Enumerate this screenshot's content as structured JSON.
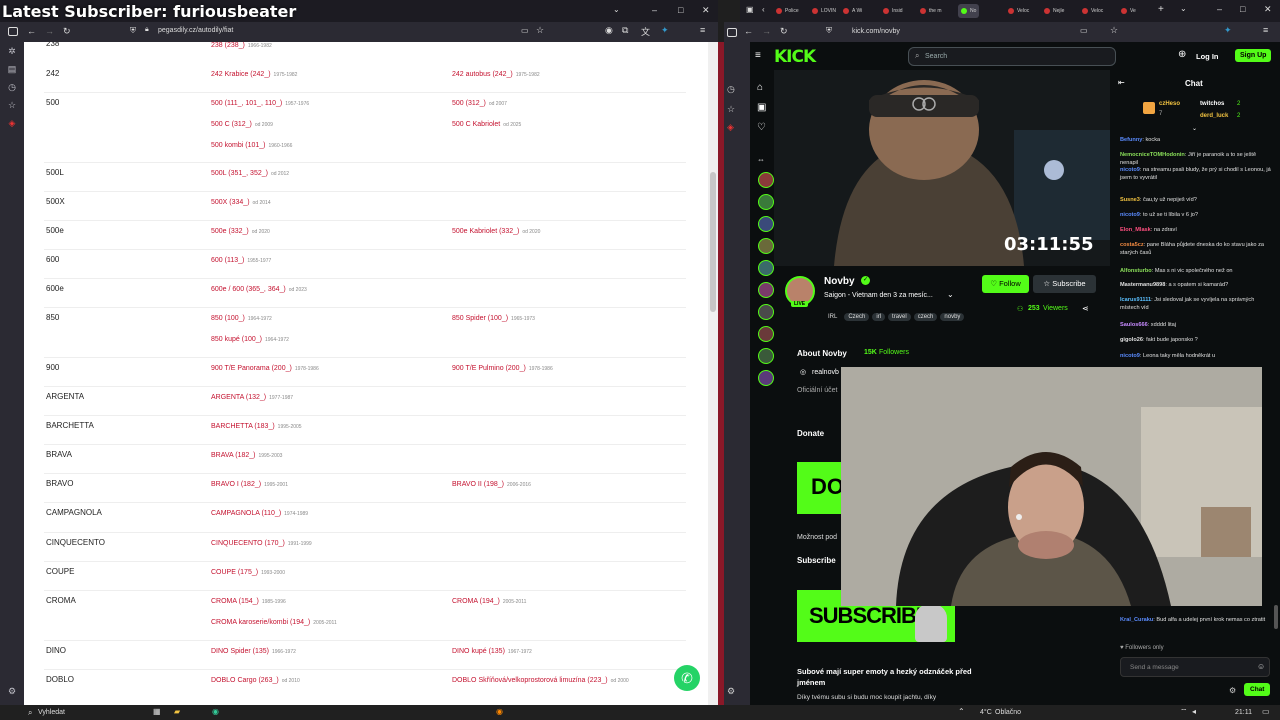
{
  "overlay": {
    "title": "Latest Subscriber: furiousbeater"
  },
  "left": {
    "url": "pegasdily.cz/autodily/fiat",
    "sidebar_icons": [
      "grid-icon",
      "home-icon",
      "download-icon",
      "star-icon",
      "history-icon"
    ],
    "top_partial": {
      "text": "238 (238_)",
      "years": "1966-1982"
    },
    "rows": [
      {
        "model": "242",
        "links": [
          {
            "t": "242 Krabice (242_)",
            "y": "1975-1982"
          },
          {
            "t": "242 autobus (242_)",
            "y": "1975-1982"
          }
        ]
      },
      {
        "model": "500",
        "links": [
          {
            "t": "500 (111_, 101_, 110_)",
            "y": "1957-1976"
          },
          {
            "t": "500 (312_)",
            "y": "od 2007"
          },
          {
            "t": "500 C (312_)",
            "y": "od 2009"
          },
          {
            "t": "500 C Kabriolet",
            "y": "od 2025"
          },
          {
            "t": "500 kombi (101_)",
            "y": "1960-1966"
          }
        ]
      },
      {
        "model": "500L",
        "links": [
          {
            "t": "500L (351_, 352_)",
            "y": "od 2012"
          }
        ]
      },
      {
        "model": "500X",
        "links": [
          {
            "t": "500X (334_)",
            "y": "od 2014"
          }
        ]
      },
      {
        "model": "500e",
        "links": [
          {
            "t": "500e (332_)",
            "y": "od 2020"
          },
          {
            "t": "500e Kabriolet (332_)",
            "y": "od 2020"
          }
        ]
      },
      {
        "model": "600",
        "links": [
          {
            "t": "600 (113_)",
            "y": "1955-1977"
          }
        ]
      },
      {
        "model": "600e",
        "links": [
          {
            "t": "600e / 600 (365_, 364_)",
            "y": "od 2023"
          }
        ]
      },
      {
        "model": "850",
        "links": [
          {
            "t": "850 (100_)",
            "y": "1964-1972"
          },
          {
            "t": "850 Spider (100_)",
            "y": "1965-1973"
          },
          {
            "t": "850 kupé (100_)",
            "y": "1964-1972"
          }
        ]
      },
      {
        "model": "900",
        "links": [
          {
            "t": "900 T/E Panorama (200_)",
            "y": "1978-1986"
          },
          {
            "t": "900 T/E Pulmino (200_)",
            "y": "1978-1986"
          }
        ]
      },
      {
        "model": "ARGENTA",
        "links": [
          {
            "t": "ARGENTA (132_)",
            "y": "1977-1987"
          }
        ]
      },
      {
        "model": "BARCHETTA",
        "links": [
          {
            "t": "BARCHETTA (183_)",
            "y": "1995-2005"
          }
        ]
      },
      {
        "model": "BRAVA",
        "links": [
          {
            "t": "BRAVA (182_)",
            "y": "1995-2003"
          }
        ]
      },
      {
        "model": "BRAVO",
        "links": [
          {
            "t": "BRAVO I (182_)",
            "y": "1995-2001"
          },
          {
            "t": "BRAVO II (198_)",
            "y": "2006-2016"
          }
        ]
      },
      {
        "model": "CAMPAGNOLA",
        "links": [
          {
            "t": "CAMPAGNOLA (110_)",
            "y": "1974-1989"
          }
        ]
      },
      {
        "model": "CINQUECENTO",
        "links": [
          {
            "t": "CINQUECENTO (170_)",
            "y": "1991-1999"
          }
        ]
      },
      {
        "model": "COUPE",
        "links": [
          {
            "t": "COUPE (175_)",
            "y": "1993-2000"
          }
        ]
      },
      {
        "model": "CROMA",
        "links": [
          {
            "t": "CROMA (154_)",
            "y": "1985-1996"
          },
          {
            "t": "CROMA (194_)",
            "y": "2005-2011"
          },
          {
            "t": "CROMA karoserie/kombi (194_)",
            "y": "2005-2011"
          }
        ]
      },
      {
        "model": "DINO",
        "links": [
          {
            "t": "DINO Spider (135)",
            "y": "1966-1972"
          },
          {
            "t": "DINO kupé (135)",
            "y": "1967-1972"
          }
        ]
      },
      {
        "model": "DOBLO",
        "links": [
          {
            "t": "DOBLO Cargo (263_)",
            "y": "od 2010"
          },
          {
            "t": "DOBLO Skříňová/velkoprostorová limuzína (223_)",
            "y": "od 2000"
          }
        ]
      }
    ]
  },
  "right": {
    "url": "kick.com/novby",
    "tabs": [
      "Police",
      "LOVIN",
      "A Wi",
      "Insid",
      "the m",
      "No",
      "Veloc",
      "Nejle",
      "Veloc",
      "Ve"
    ],
    "kick": {
      "logo": "KICK",
      "search_placeholder": "Search",
      "login": "Log In",
      "signup": "Sign Up",
      "timer": "03:11:55",
      "streamer": "Novby",
      "stream_title": "Saigon - Vietnam den 3 za mesíc...",
      "tags": [
        "IRL",
        "Czech",
        "irl",
        "travel",
        "czech",
        "novby"
      ],
      "live_badge": "LIVE",
      "follow": "Follow",
      "subscribe": "Subscribe",
      "viewers": "253",
      "viewers_label": "Viewers",
      "about": "About Novby",
      "followers_count": "15K",
      "followers_label": "Followers",
      "instagram": "realnovb",
      "official": "Oficiální účet",
      "donate": "Donate",
      "donate_banner": "DO",
      "donate_text": "Možnost pod",
      "subscribe_heading": "Subscribe",
      "subscribe_banner": "SUBSCRIBE",
      "sub_title": "Subové mají super emoty a hezký odznáček před jménem",
      "sub_text": "Díky tvému subu si budu moc koupit jachtu, díky"
    },
    "chat": {
      "title": "Chat",
      "top_users": [
        {
          "name": "czHeso",
          "count": "7"
        },
        {
          "name": "twitchos",
          "count": "2"
        },
        {
          "name": "derd_luck",
          "count": "2"
        }
      ],
      "messages": [
        {
          "user": "Befunny",
          "color": "#5b8cff",
          "text": "kocka"
        },
        {
          "user": "NemocniceTOMHodonin",
          "color": "#8be05a",
          "text": "Jiří je paranoik a to se ještě nenapil"
        },
        {
          "user": "nicoto9",
          "color": "#5b8cff",
          "text": "na streamu psali bludy, že prý si chodil s Leonou, já jsem to vyvrátil"
        },
        {
          "user": "Susne3",
          "color": "#f2c341",
          "text": "čau,ty už nepiješ víd?"
        },
        {
          "user": "nicoto9",
          "color": "#5b8cff",
          "text": "to už se ti líbila v 6 jo?"
        },
        {
          "user": "Elon_Mlask",
          "color": "#ff4f7f",
          "text": "na zdraví"
        },
        {
          "user": "costa5cz",
          "color": "#f28a41",
          "text": "pane Bláha půjdete dneska do ko stavu jako za starých časů"
        },
        {
          "user": "Alfonsturbo",
          "color": "#8be05a",
          "text": "Mas s ni vic společného než on"
        },
        {
          "user": "Mastermanu9898",
          "color": "#e0e0e0",
          "text": "a s opatem si kamarád?"
        },
        {
          "user": "Icarus91111",
          "color": "#5bc0ff",
          "text": "Jsi sledoval jak se vyvíjela na správných místech víd"
        },
        {
          "user": "Saulos666",
          "color": "#c78bff",
          "text": "xdddd litaj"
        },
        {
          "user": "gigolo26",
          "color": "#e0e0e0",
          "text": "fakt bude japonsko ?"
        },
        {
          "user": "nicoto9",
          "color": "#5b8cff",
          "text": "Leona taky měla hodněkrát u"
        },
        {
          "user": "Kral_Curaku",
          "color": "#5b8cff",
          "text": "Bud alfa a udelej první krok nemas co ztratit"
        }
      ],
      "followers_only": "Followers only",
      "send_placeholder": "Send a message",
      "chat_button": "Chat"
    }
  },
  "taskbar": {
    "search": "Vyhledat",
    "weather": "4°C",
    "weather_text": "Oblačno",
    "time": "21:11"
  }
}
